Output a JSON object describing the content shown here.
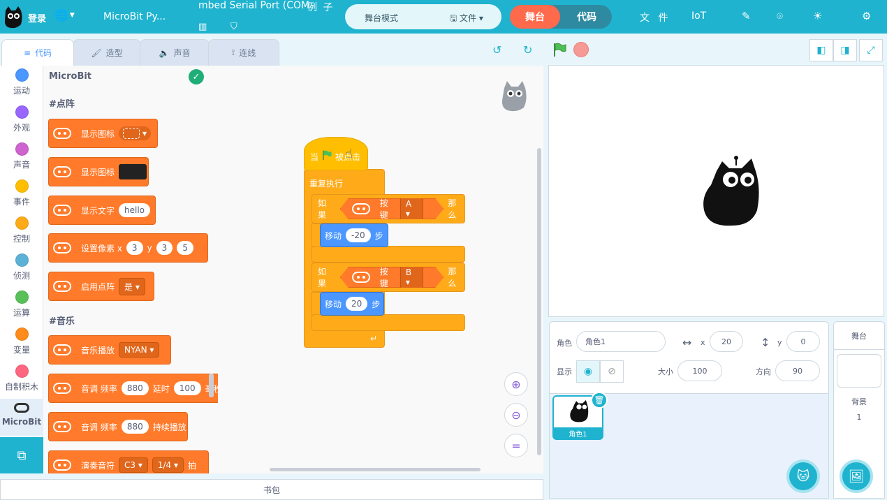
{
  "topbar": {
    "login": "登录",
    "project_name": "MicroBit Py...",
    "serial_port": "mbed Serial Port (COM",
    "examples": "例 子",
    "mode_label": "舞台模式",
    "file_menu": "文件",
    "stage_toggle": "舞台",
    "code_toggle": "代码",
    "file": "文 件",
    "iot": "IoT"
  },
  "tabs": [
    {
      "label": "代码"
    },
    {
      "label": "造型"
    },
    {
      "label": "声音"
    },
    {
      "label": "连线"
    }
  ],
  "categories": [
    {
      "label": "运动",
      "color": "#4c97ff"
    },
    {
      "label": "外观",
      "color": "#9966ff"
    },
    {
      "label": "声音",
      "color": "#cf63cf"
    },
    {
      "label": "事件",
      "color": "#ffbf00"
    },
    {
      "label": "控制",
      "color": "#ffab19"
    },
    {
      "label": "侦测",
      "color": "#5cb1d6"
    },
    {
      "label": "运算",
      "color": "#59c059"
    },
    {
      "label": "变量",
      "color": "#ff8c1a"
    },
    {
      "label": "自制积木",
      "color": "#ff6680"
    },
    {
      "label": "MicroBit",
      "color": "#333333"
    }
  ],
  "palette": {
    "title": "MicroBit",
    "section_matrix": "#点阵",
    "section_music": "#音乐",
    "blocks": {
      "show_icon_1": "显示图标",
      "show_icon_2": "显示图标",
      "show_text": "显示文字",
      "show_text_value": "hello",
      "set_pixel": "设置像素 x",
      "set_pixel_x": "3",
      "set_pixel_y_label": "y",
      "set_pixel_y": "3",
      "set_pixel_b": "5",
      "enable_matrix": "启用点阵",
      "enable_matrix_value": "是",
      "play_music": "音乐播放",
      "play_music_value": "NYAN",
      "tone": "音调 频率",
      "tone_freq": "880",
      "tone_delay_label": "延时",
      "tone_delay": "100",
      "tone_tail": "毫秒",
      "tone2": "音调 频率",
      "tone2_freq": "880",
      "tone2_tail": "持续播放",
      "play_note": "演奏音符",
      "play_note_value": "C3",
      "play_note_beat": "1/4",
      "play_note_tail": "拍"
    }
  },
  "script": {
    "hat_prefix": "当",
    "hat_suffix": "被点击",
    "forever": "重复执行",
    "if1": "如果",
    "button1": "按键",
    "button1_value": "A",
    "then1": "那么",
    "move1": "移动",
    "move1_value": "-20",
    "steps1": "步",
    "if2": "如果",
    "button2": "按键",
    "button2_value": "B",
    "then2": "那么",
    "move2": "移动",
    "move2_value": "20",
    "steps2": "步"
  },
  "sprite_info": {
    "sprite_label": "角色",
    "sprite_name": "角色1",
    "x_label": "x",
    "x_value": "20",
    "y_label": "y",
    "y_value": "0",
    "show_label": "显示",
    "size_label": "大小",
    "size_value": "100",
    "direction_label": "方向",
    "direction_value": "90"
  },
  "sprite_list": [
    {
      "name": "角色1"
    }
  ],
  "stage_selector": {
    "title": "舞台",
    "backdrop_label": "背景",
    "backdrop_count": "1"
  },
  "backpack": "书包",
  "colors": {
    "accent": "#1fb3cf",
    "stage_toggle": "#ff6a4d",
    "microbit_block": "#ff7a2a",
    "control_block": "#ffab19",
    "motion_block": "#4c97ff"
  }
}
